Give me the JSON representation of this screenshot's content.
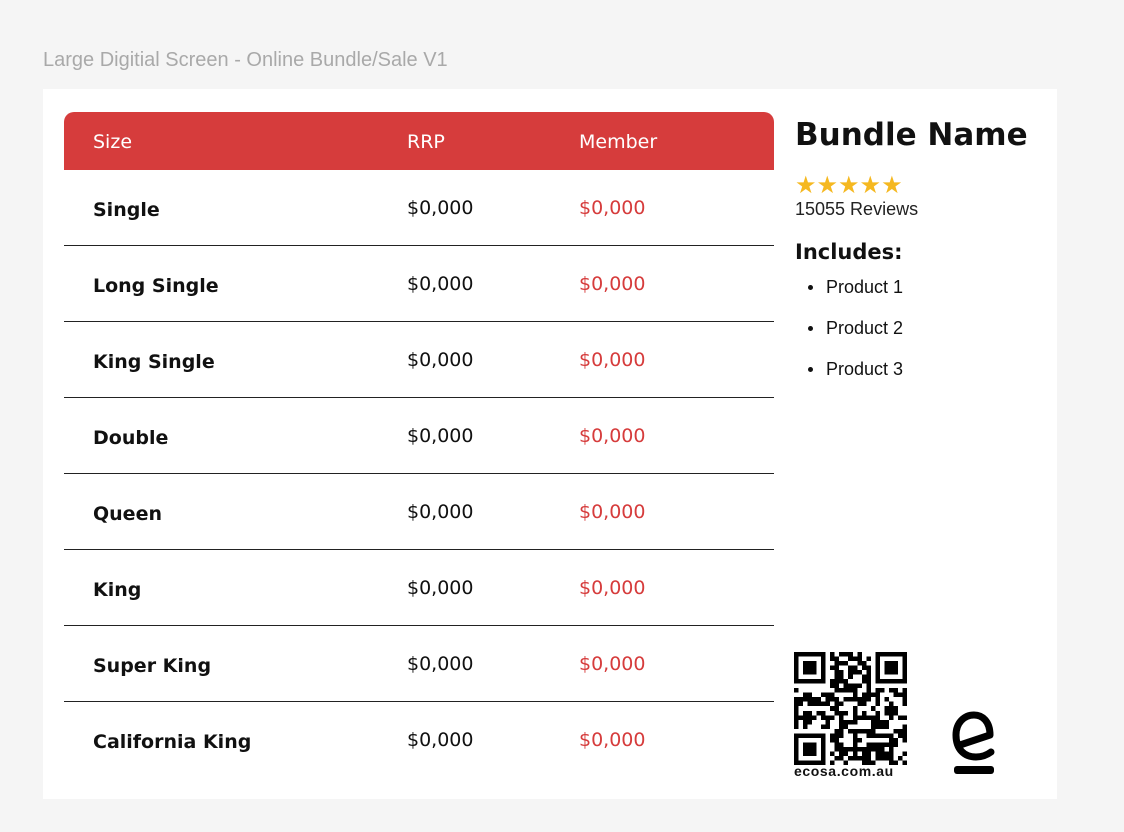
{
  "frame_label": "Large Digitial Screen - Online Bundle/Sale V1",
  "colors": {
    "accent": "#d63c3c",
    "member_price": "#d63c3c",
    "stars": "#f5b820"
  },
  "table": {
    "headers": [
      "Size",
      "RRP",
      "Member"
    ],
    "rows": [
      {
        "size": "Single",
        "rrp": "$0,000",
        "member": "$0,000"
      },
      {
        "size": "Long Single",
        "rrp": "$0,000",
        "member": "$0,000"
      },
      {
        "size": "King Single",
        "rrp": "$0,000",
        "member": "$0,000"
      },
      {
        "size": "Double",
        "rrp": "$0,000",
        "member": "$0,000"
      },
      {
        "size": "Queen",
        "rrp": "$0,000",
        "member": "$0,000"
      },
      {
        "size": "King",
        "rrp": "$0,000",
        "member": "$0,000"
      },
      {
        "size": "Super King",
        "rrp": "$0,000",
        "member": "$0,000"
      },
      {
        "size": "California King",
        "rrp": "$0,000",
        "member": "$0,000"
      }
    ]
  },
  "bundle": {
    "name": "Bundle Name",
    "rating": 5,
    "rating_max": 5,
    "stars_text": "★★★★★",
    "reviews": "15055 Reviews",
    "includes_label": "Includes:",
    "products": [
      "Product 1",
      "Product 2",
      "Product 3"
    ]
  },
  "footer": {
    "qr_icon": "qr-code-icon",
    "website": "ecosa.com.au",
    "logo_icon": "ecosa-logo-icon"
  }
}
